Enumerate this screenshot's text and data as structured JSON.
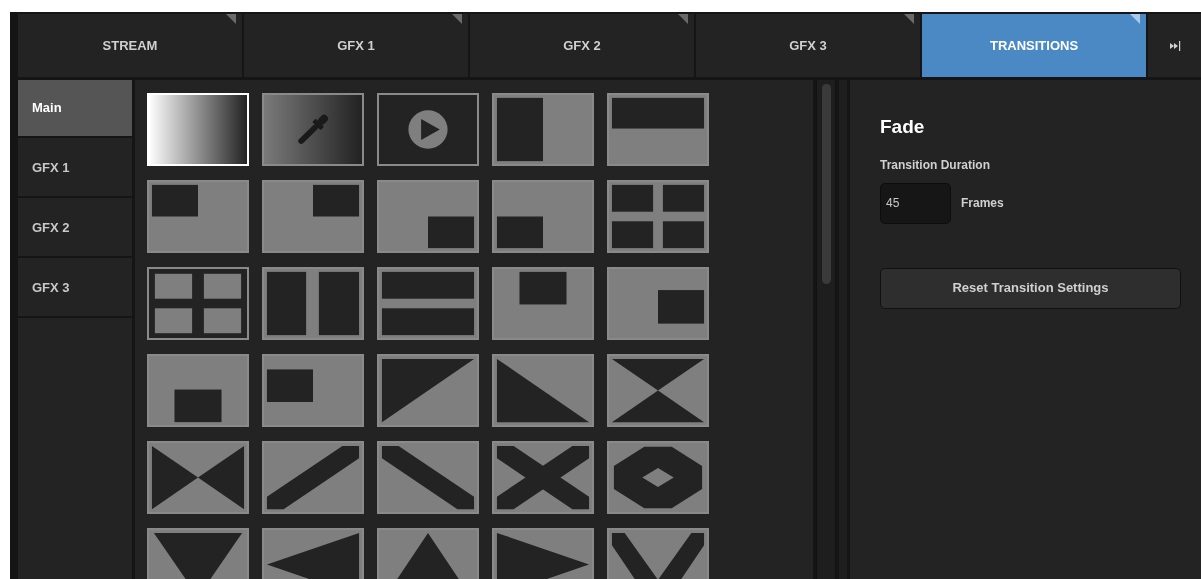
{
  "tabs": [
    {
      "label": "STREAM",
      "selected": false
    },
    {
      "label": "GFX 1",
      "selected": false
    },
    {
      "label": "GFX 2",
      "selected": false
    },
    {
      "label": "GFX 3",
      "selected": false
    },
    {
      "label": "TRANSITIONS",
      "selected": true
    }
  ],
  "sidebar": {
    "items": [
      {
        "label": "Main",
        "selected": true
      },
      {
        "label": "GFX 1",
        "selected": false
      },
      {
        "label": "GFX 2",
        "selected": false
      },
      {
        "label": "GFX 3",
        "selected": false
      }
    ]
  },
  "transitions": [
    {
      "kind": "fade",
      "selected": true
    },
    {
      "kind": "color",
      "selected": false
    },
    {
      "kind": "stinger",
      "selected": false
    },
    {
      "kind": "split-left",
      "selected": false
    },
    {
      "kind": "bar-top",
      "selected": false
    },
    {
      "kind": "box-tl",
      "selected": false
    },
    {
      "kind": "box-tr",
      "selected": false
    },
    {
      "kind": "box-br",
      "selected": false
    },
    {
      "kind": "box-bl",
      "selected": false
    },
    {
      "kind": "quad-dark",
      "selected": false
    },
    {
      "kind": "quad-gray",
      "selected": false
    },
    {
      "kind": "vsplit",
      "selected": false
    },
    {
      "kind": "hsplit",
      "selected": false
    },
    {
      "kind": "box-top",
      "selected": false
    },
    {
      "kind": "box-right",
      "selected": false
    },
    {
      "kind": "box-bottom",
      "selected": false
    },
    {
      "kind": "box-left",
      "selected": false
    },
    {
      "kind": "diag-tl",
      "selected": false
    },
    {
      "kind": "diag-bl",
      "selected": false
    },
    {
      "kind": "hourglass",
      "selected": false
    },
    {
      "kind": "bowtie",
      "selected": false
    },
    {
      "kind": "slash",
      "selected": false
    },
    {
      "kind": "backslash",
      "selected": false
    },
    {
      "kind": "cross",
      "selected": false
    },
    {
      "kind": "ring",
      "selected": false
    },
    {
      "kind": "tri-down",
      "selected": false
    },
    {
      "kind": "tri-left",
      "selected": false
    },
    {
      "kind": "tri-up",
      "selected": false
    },
    {
      "kind": "tri-right",
      "selected": false
    },
    {
      "kind": "vee",
      "selected": false
    }
  ],
  "settings": {
    "title": "Fade",
    "duration_label": "Transition Duration",
    "duration_value": "45",
    "unit": "Frames",
    "reset_button": "Reset Transition Settings"
  }
}
